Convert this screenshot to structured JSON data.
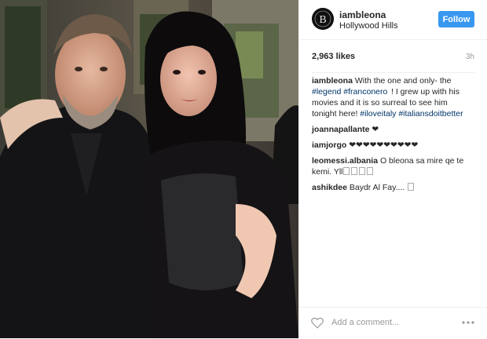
{
  "header": {
    "username": "iambleona",
    "location": "Hollywood Hills",
    "follow_label": "Follow",
    "avatar_icon": "avatar-logo-b"
  },
  "stats": {
    "likes": "2,963 likes",
    "time": "3h"
  },
  "caption": {
    "user": "iambleona",
    "text_1": " With the one and only- the ",
    "tag_1": "#legend",
    "space": " ",
    "tag_2": "#franconero",
    "text_2": "  ! I grew up with his movies and it is so surreal to see him tonight here! ",
    "tag_3": "#iloveitaly",
    "tag_4": "#italiansdoitbetter"
  },
  "comments": [
    {
      "user": "joannapallante",
      "text": " ❤"
    },
    {
      "user": "iamjorgo",
      "text": " ❤❤❤❤❤❤❤❤❤❤"
    },
    {
      "user": "leomessi.albania",
      "text": " O bleona sa mire qe te kemi. Yll"
    },
    {
      "user": "ashikdee",
      "text": " Baydr Al Fay.... "
    }
  ],
  "footer": {
    "comment_placeholder": "Add a comment...",
    "like_icon": "heart-outline-icon",
    "more_icon": "more-options-icon"
  },
  "colors": {
    "follow_button": "#3897f0",
    "hashtag": "#003569",
    "muted": "#999999"
  }
}
